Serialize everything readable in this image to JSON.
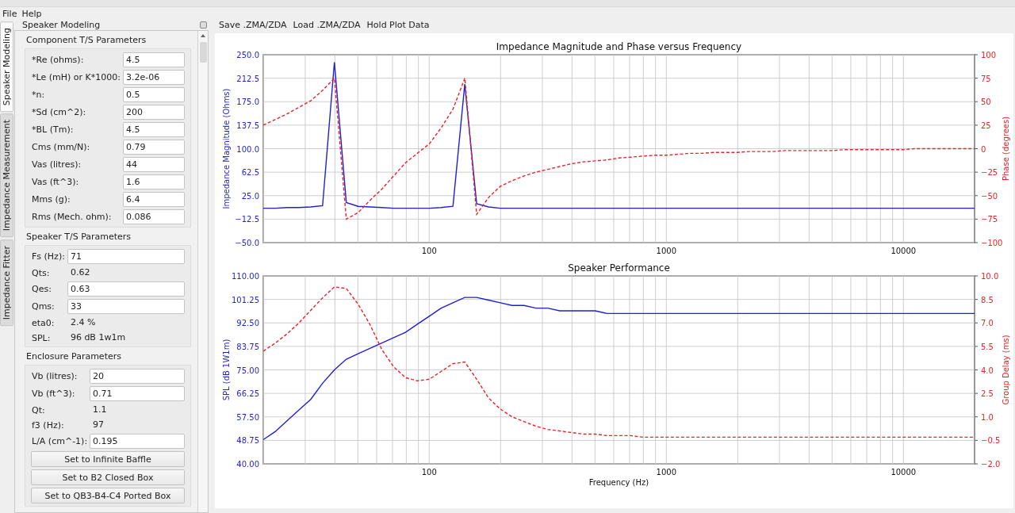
{
  "menu": [
    {
      "label": "File"
    },
    {
      "label": "Help"
    }
  ],
  "side_tabs": [
    {
      "label": "Speaker Modeling",
      "selected": true
    },
    {
      "label": "Impedance Measurement",
      "selected": false
    },
    {
      "label": "Impedance Fitter",
      "selected": false
    }
  ],
  "dock": {
    "title": "Speaker Modeling"
  },
  "groups": [
    {
      "title": "Component T/S Parameters",
      "fields": [
        {
          "label": "*Re (ohms):",
          "kind": "input",
          "value": "4.5"
        },
        {
          "label": "*Le (mH) or K*1000:",
          "kind": "input",
          "value": "3.2e-06"
        },
        {
          "label": "*n:",
          "kind": "input",
          "value": "0.5"
        },
        {
          "label": "*Sd (cm^2):",
          "kind": "input",
          "value": "200"
        },
        {
          "label": "*BL (Tm):",
          "kind": "input",
          "value": "4.5"
        },
        {
          "label": "Cms (mm/N):",
          "kind": "input",
          "value": "0.79"
        },
        {
          "label": "Vas (litres):",
          "kind": "input",
          "value": "44"
        },
        {
          "label": "Vas (ft^3):",
          "kind": "input",
          "value": "1.6"
        },
        {
          "label": "Mms (g):",
          "kind": "input",
          "value": "6.4"
        },
        {
          "label": "Rms (Mech. ohm):",
          "kind": "input",
          "value": "0.086"
        }
      ]
    },
    {
      "title": "Speaker T/S Parameters",
      "fields": [
        {
          "label": "Fs (Hz):",
          "kind": "input",
          "value": "71"
        },
        {
          "label": "Qts:",
          "kind": "text",
          "value": "0.62"
        },
        {
          "label": "Qes:",
          "kind": "input",
          "value": "0.63"
        },
        {
          "label": "Qms:",
          "kind": "input",
          "value": "33"
        },
        {
          "label": "eta0:",
          "kind": "text",
          "value": "2.4 %"
        },
        {
          "label": "SPL:",
          "kind": "text",
          "value": "96 dB 1w1m"
        }
      ]
    },
    {
      "title": "Enclosure Parameters",
      "fields": [
        {
          "label": "Vb (litres):",
          "kind": "input",
          "value": "20"
        },
        {
          "label": "Vb (ft^3):",
          "kind": "input",
          "value": "0.71"
        },
        {
          "label": "Qt:",
          "kind": "text",
          "value": "1.1"
        },
        {
          "label": "f3 (Hz):",
          "kind": "text",
          "value": "97"
        },
        {
          "label": "L/A (cm^-1):",
          "kind": "input",
          "value": "0.195"
        }
      ],
      "buttons": [
        "Set to Infinite Baffle",
        "Set to B2 Closed Box",
        "Set to QB3-B4-C4 Ported Box"
      ]
    }
  ],
  "toolbar": [
    "Save .ZMA/ZDA",
    "Load .ZMA/ZDA",
    "Hold Plot Data"
  ],
  "plots": [
    {
      "axes": [
        {
          "chart_data": {
            "type": "line",
            "title": "Impedance Magnitude and Phase versus Frequency",
            "ylabel": "Impedance Magnitude (Ohms)",
            "grid": true,
            "categories": [
              null,
              null,
              null,
              null,
              null,
              null,
              null,
              null,
              null,
              null,
              null,
              null,
              null,
              null,
              "100",
              null,
              null,
              null,
              null,
              null,
              null,
              null,
              null,
              null,
              null,
              null,
              null,
              null,
              null,
              null,
              null,
              null,
              null,
              null,
              "1000",
              null,
              null,
              null,
              null,
              null,
              null,
              null,
              null,
              null,
              null,
              null,
              null,
              null,
              null,
              null,
              null,
              null,
              null,
              null,
              "10000",
              null,
              null,
              null,
              null,
              null,
              null
            ],
            "ylim": [
              -50,
              250
            ],
            "yticks": [
              {
                "value": -50,
                "label": "−50.0"
              },
              {
                "value": -12.5,
                "label": "−12.5"
              },
              {
                "value": 25,
                "label": "25.0"
              },
              {
                "value": 62.5,
                "label": "62.5"
              },
              {
                "value": 100,
                "label": "100.0"
              },
              {
                "value": 137.5,
                "label": "137.5"
              },
              {
                "value": 175,
                "label": "175.0"
              },
              {
                "value": 212.5,
                "label": "212.5"
              },
              {
                "value": 250,
                "label": "250.0"
              }
            ],
            "series": [
              {
                "color": "#1f1fd6",
                "line_style": "solid",
                "values": [
                  5,
                  5,
                  6,
                  6,
                  7,
                  9,
                  238,
                  14,
                  8,
                  7,
                  6,
                  5,
                  5,
                  5,
                  5,
                  6,
                  8,
                  203,
                  12,
                  7,
                  5,
                  5,
                  5,
                  5,
                  5,
                  5,
                  5,
                  5,
                  5,
                  5,
                  5,
                  5,
                  5,
                  5,
                  5,
                  5,
                  5,
                  5,
                  5,
                  5,
                  5,
                  5,
                  5,
                  5,
                  5,
                  5,
                  5,
                  5,
                  5,
                  5,
                  5,
                  5,
                  5,
                  5,
                  5,
                  5,
                  5,
                  5,
                  5,
                  5,
                  5
                ]
              }
            ]
          }
        },
        {
          "chart_data": {
            "type": "line",
            "ylabel": "Phase (degrees)",
            "categories": [
              null,
              null,
              null,
              null,
              null,
              null,
              null,
              null,
              null,
              null,
              null,
              null,
              null,
              null,
              null,
              null,
              null,
              null,
              null,
              null,
              null,
              null,
              null,
              null,
              null,
              null,
              null,
              null,
              null,
              null,
              null,
              null,
              null,
              null,
              null,
              null,
              null,
              null,
              null,
              null,
              null,
              null,
              null,
              null,
              null,
              null,
              null,
              null,
              null,
              null,
              null,
              null,
              null,
              null,
              null,
              null,
              null,
              null,
              null,
              null,
              null
            ],
            "ylim": [
              -100,
              100
            ],
            "yticks": [
              {
                "value": -100,
                "label": "−100"
              },
              {
                "value": -75,
                "label": "−75"
              },
              {
                "value": -50,
                "label": "−50"
              },
              {
                "value": -25,
                "label": "−25"
              },
              0,
              25,
              50,
              75,
              100
            ],
            "series": [
              {
                "color": "#e8242a",
                "line_style": "dashed",
                "values": [
                  25,
                  31,
                  37,
                  44,
                  51,
                  62,
                  75,
                  -75,
                  -68,
                  -55,
                  -43,
                  -29,
                  -15,
                  -5,
                  5,
                  22,
                  42,
                  75,
                  -70,
                  -52,
                  -40,
                  -34,
                  -29,
                  -25,
                  -22,
                  -19,
                  -16,
                  -14,
                  -13,
                  -12,
                  -10,
                  -9,
                  -8,
                  -7,
                  -7,
                  -6,
                  -5,
                  -5,
                  -4,
                  -4,
                  -4,
                  -3,
                  -3,
                  -3,
                  -2,
                  -2,
                  -2,
                  -2,
                  -2,
                  -1,
                  -1,
                  -1,
                  -1,
                  -1,
                  -1,
                  0,
                  0,
                  0,
                  0,
                  0,
                  0
                ]
              }
            ]
          }
        }
      ]
    },
    {
      "axes": [
        {
          "chart_data": {
            "type": "line",
            "title": "Speaker Performance",
            "xlabel": "Frequency (Hz)",
            "ylabel": "SPL (dB 1W1m)",
            "grid": true,
            "categories": [
              null,
              null,
              null,
              null,
              null,
              null,
              null,
              null,
              null,
              null,
              null,
              null,
              null,
              null,
              "100",
              null,
              null,
              null,
              null,
              null,
              null,
              null,
              null,
              null,
              null,
              null,
              null,
              null,
              null,
              null,
              null,
              null,
              null,
              null,
              "1000",
              null,
              null,
              null,
              null,
              null,
              null,
              null,
              null,
              null,
              null,
              null,
              null,
              null,
              null,
              null,
              null,
              null,
              null,
              null,
              "10000",
              null,
              null,
              null,
              null,
              null,
              null
            ],
            "ylim": [
              40,
              110
            ],
            "yticks": [
              {
                "value": 40,
                "label": "40.00"
              },
              {
                "value": 48.75,
                "label": "48.75"
              },
              {
                "value": 57.5,
                "label": "57.50"
              },
              {
                "value": 66.25,
                "label": "66.25"
              },
              {
                "value": 75,
                "label": "75.00"
              },
              {
                "value": 83.75,
                "label": "83.75"
              },
              {
                "value": 92.5,
                "label": "92.50"
              },
              {
                "value": 101.25,
                "label": "101.25"
              },
              {
                "value": 110,
                "label": "110.00"
              }
            ],
            "series": [
              {
                "color": "#1f1fd6",
                "line_style": "solid",
                "values": [
                  49,
                  52,
                  56,
                  60,
                  64,
                  70,
                  75,
                  79,
                  81,
                  83,
                  85,
                  87,
                  89,
                  92,
                  95,
                  98,
                  100,
                  102,
                  102,
                  101,
                  100,
                  99,
                  99,
                  98,
                  98,
                  97,
                  97,
                  97,
                  97,
                  96,
                  96,
                  96,
                  96,
                  96,
                  96,
                  96,
                  96,
                  96,
                  96,
                  96,
                  96,
                  96,
                  96,
                  96,
                  96,
                  96,
                  96,
                  96,
                  96,
                  96,
                  96,
                  96,
                  96,
                  96,
                  96,
                  96,
                  96,
                  96,
                  96,
                  96,
                  96
                ]
              }
            ]
          }
        },
        {
          "chart_data": {
            "type": "line",
            "ylabel": "Group Delay (ms)",
            "categories": [
              null,
              null,
              null,
              null,
              null,
              null,
              null,
              null,
              null,
              null,
              null,
              null,
              null,
              null,
              null,
              null,
              null,
              null,
              null,
              null,
              null,
              null,
              null,
              null,
              null,
              null,
              null,
              null,
              null,
              null,
              null,
              null,
              null,
              null,
              null,
              null,
              null,
              null,
              null,
              null,
              null,
              null,
              null,
              null,
              null,
              null,
              null,
              null,
              null,
              null,
              null,
              null,
              null,
              null,
              null,
              null,
              null,
              null,
              null,
              null,
              null
            ],
            "ylim": [
              -2,
              10
            ],
            "yticks": [
              {
                "value": -2,
                "label": "−2.0"
              },
              {
                "value": -0.5,
                "label": "−0.5"
              },
              {
                "value": 1,
                "label": "1.0"
              },
              {
                "value": 2.5,
                "label": "2.5"
              },
              {
                "value": 4,
                "label": "4.0"
              },
              {
                "value": 5.5,
                "label": "5.5"
              },
              {
                "value": 7,
                "label": "7.0"
              },
              {
                "value": 8.5,
                "label": "8.5"
              },
              {
                "value": 10,
                "label": "10.0"
              }
            ],
            "series": [
              {
                "color": "#e8242a",
                "line_style": "dashed",
                "values": [
                  5.2,
                  5.7,
                  6.3,
                  7,
                  7.8,
                  8.6,
                  9.3,
                  9.2,
                  8.2,
                  6.9,
                  5.3,
                  4.2,
                  3.5,
                  3.3,
                  3.4,
                  3.9,
                  4.4,
                  4.5,
                  3.4,
                  2.2,
                  1.5,
                  1,
                  0.7,
                  0.4,
                  0.2,
                  0.1,
                  0,
                  -0.1,
                  -0.1,
                  -0.2,
                  -0.2,
                  -0.2,
                  -0.3,
                  -0.3,
                  -0.3,
                  -0.3,
                  -0.3,
                  -0.3,
                  -0.3,
                  -0.3,
                  -0.3,
                  -0.3,
                  -0.3,
                  -0.3,
                  -0.3,
                  -0.3,
                  -0.3,
                  -0.3,
                  -0.3,
                  -0.3,
                  -0.3,
                  -0.3,
                  -0.3,
                  -0.3,
                  -0.3,
                  -0.3,
                  -0.3,
                  -0.3,
                  -0.3,
                  -0.3,
                  -0.3
                ]
              }
            ]
          }
        }
      ]
    }
  ]
}
